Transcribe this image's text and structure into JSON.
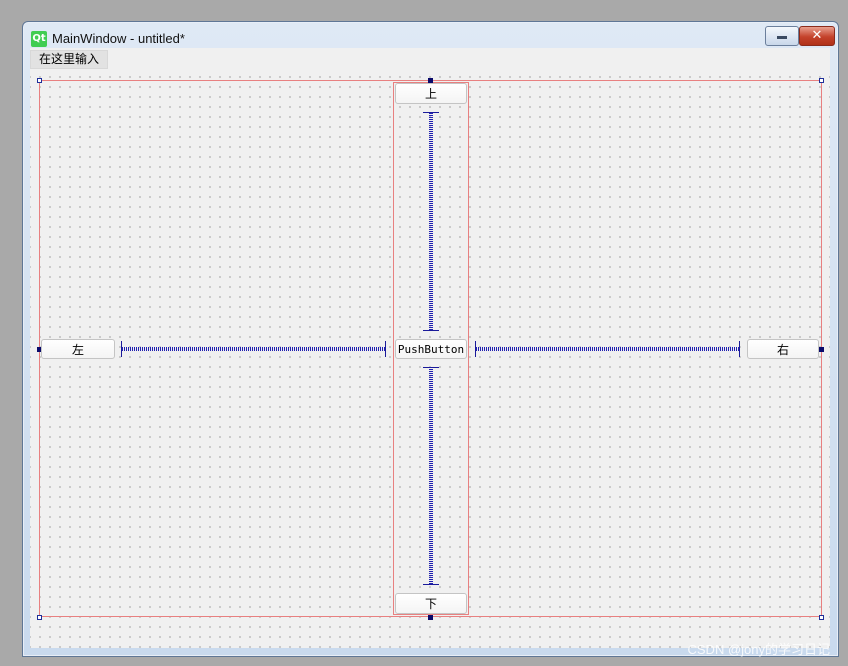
{
  "window": {
    "title": "MainWindow - untitled*",
    "icon": "qt-logo",
    "controls": {
      "minimize": "minimize-icon",
      "close": "close-icon"
    }
  },
  "menubar": {
    "items": [
      {
        "label": "在这里输入"
      }
    ]
  },
  "form": {
    "buttons": {
      "top": "上",
      "bottom": "下",
      "left": "左",
      "right": "右",
      "center": "PushButton"
    }
  },
  "colors": {
    "layout_border": "#e88080",
    "spacer": "#2020b0",
    "handle": "#1f2f99"
  },
  "watermark": "CSDN @jony的学习日记"
}
